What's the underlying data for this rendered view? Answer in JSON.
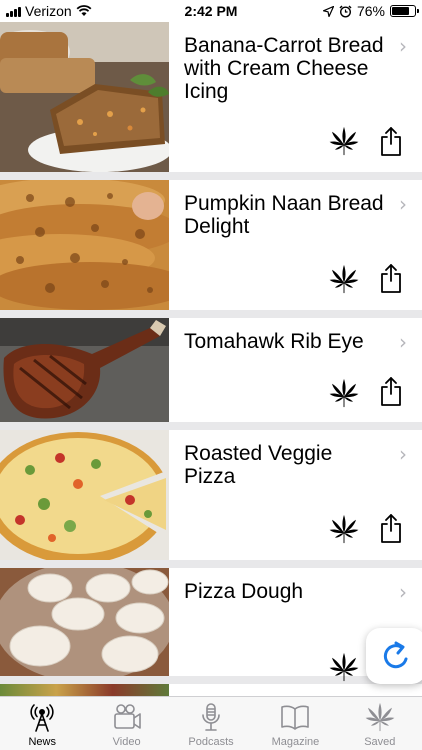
{
  "status_bar": {
    "carrier": "Verizon",
    "time": "2:42 PM",
    "battery_percent": "76%",
    "battery_level": 0.76,
    "icons": [
      "signal-icon",
      "wifi-icon",
      "location-icon",
      "alarm-icon",
      "battery-icon"
    ]
  },
  "feed": {
    "items": [
      {
        "title": "Banana-Carrot Bread with Cream Cheese Icing",
        "image": "banana-bread-photo"
      },
      {
        "title": "Pumpkin Naan Bread Delight",
        "image": "naan-bread-photo"
      },
      {
        "title": "Tomahawk Rib Eye",
        "image": "rib-eye-steak-photo"
      },
      {
        "title": "Roasted Veggie Pizza",
        "image": "veggie-pizza-photo"
      },
      {
        "title": "Pizza Dough",
        "image": "pizza-dough-photo"
      }
    ],
    "item_icons": [
      "cannabis-leaf-icon",
      "share-icon",
      "chevron-right-icon"
    ]
  },
  "refresh_button": {
    "icon": "refresh-icon",
    "color": "#1a7ae8"
  },
  "tab_bar": {
    "active": "News",
    "tabs": [
      {
        "label": "News",
        "icon": "radio-tower-icon"
      },
      {
        "label": "Video",
        "icon": "video-camera-icon"
      },
      {
        "label": "Podcasts",
        "icon": "microphone-icon"
      },
      {
        "label": "Magazine",
        "icon": "open-book-icon"
      },
      {
        "label": "Saved",
        "icon": "cannabis-leaf-icon"
      }
    ]
  }
}
